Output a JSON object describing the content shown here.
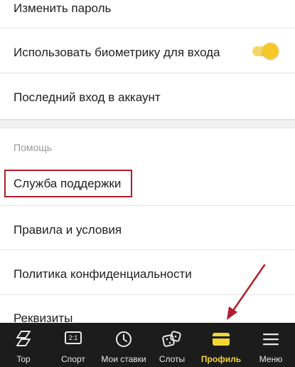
{
  "rows": {
    "change_password": "Изменить пароль",
    "biometrics": "Использовать биометрику для входа",
    "last_login": "Последний вход в аккаунт",
    "support": "Служба поддержки",
    "terms": "Правила и условия",
    "privacy": "Политика конфиденциальности",
    "requisites": "Реквизиты"
  },
  "section": {
    "help_title": "Помощь"
  },
  "toggle": {
    "biometrics_enabled": true
  },
  "tabbar": {
    "items": [
      {
        "label": "Top",
        "icon": "top-icon"
      },
      {
        "label": "Спорт",
        "icon": "sport-icon"
      },
      {
        "label": "Мои ставки",
        "icon": "clock-icon"
      },
      {
        "label": "Слоты",
        "icon": "dice-icon"
      },
      {
        "label": "Профиль",
        "icon": "card-icon",
        "active": true
      },
      {
        "label": "Меню",
        "icon": "hamburger-menu-icon"
      }
    ],
    "sport_icon_text": "2:1"
  },
  "colors": {
    "accent": "#f2d632",
    "toggle_knob": "#f7c72a",
    "highlight_border": "#b01e2c",
    "tabbar_bg": "#1c1c1c",
    "arrow": "#b01e2c"
  }
}
